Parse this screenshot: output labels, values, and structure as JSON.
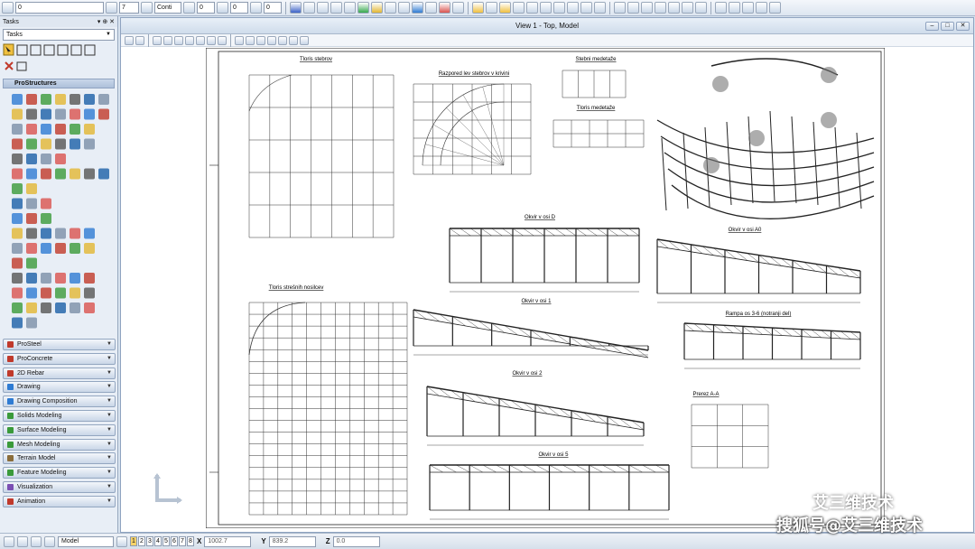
{
  "toolbar": {
    "level_value": "0",
    "weight_value": "7",
    "style_value": "Conti",
    "line_weight": "0",
    "transparency": "0",
    "priority": "0"
  },
  "tasks_panel": {
    "title": "Tasks",
    "dropdown_value": "Tasks",
    "group_title": "ProStructures",
    "categories": [
      "ProSteel",
      "ProConcrete",
      "2D Rebar",
      "Drawing",
      "Drawing Composition",
      "Solids Modeling",
      "Surface Modeling",
      "Mesh Modeling",
      "Terrain Model",
      "Feature Modeling",
      "Visualization",
      "Animation"
    ],
    "category_colors": [
      "#c0392b",
      "#c0392b",
      "#c0392b",
      "#2e7bd3",
      "#2e7bd3",
      "#3a9a3a",
      "#3a9a3a",
      "#3a9a3a",
      "#8a6d3b",
      "#3a9a3a",
      "#7b4fb3",
      "#c0392b"
    ]
  },
  "view": {
    "title": "View 1 - Top, Model",
    "drawings": [
      {
        "label": "Tloris stebrov"
      },
      {
        "label": "Razpored lev stebrov v krivini"
      },
      {
        "label": "Stebni medetaže"
      },
      {
        "label": "Tloris medetaže"
      },
      {
        "label": "Okvir v osi D"
      },
      {
        "label": "Okvir v osi A0"
      },
      {
        "label": "Tloris strešnih nosilcev"
      },
      {
        "label": "Okvir v osi 1"
      },
      {
        "label": "Rampa os 3-6 (notranji del)"
      },
      {
        "label": "Okvir v osi 2"
      },
      {
        "label": "Prerez A-A"
      },
      {
        "label": "Okvir v osi 5"
      }
    ]
  },
  "statusbar": {
    "model_label": "Model",
    "views": [
      "1",
      "2",
      "3",
      "4",
      "5",
      "6",
      "7",
      "8"
    ],
    "active_view": "1",
    "x_label": "X",
    "x_value": "1002.7",
    "y_label": "Y",
    "y_value": "839.2",
    "z_label": "Z",
    "z_value": "0.0"
  },
  "watermark": {
    "line1": "艾三维技术",
    "line2": "搜狐号@艾三维技术"
  }
}
